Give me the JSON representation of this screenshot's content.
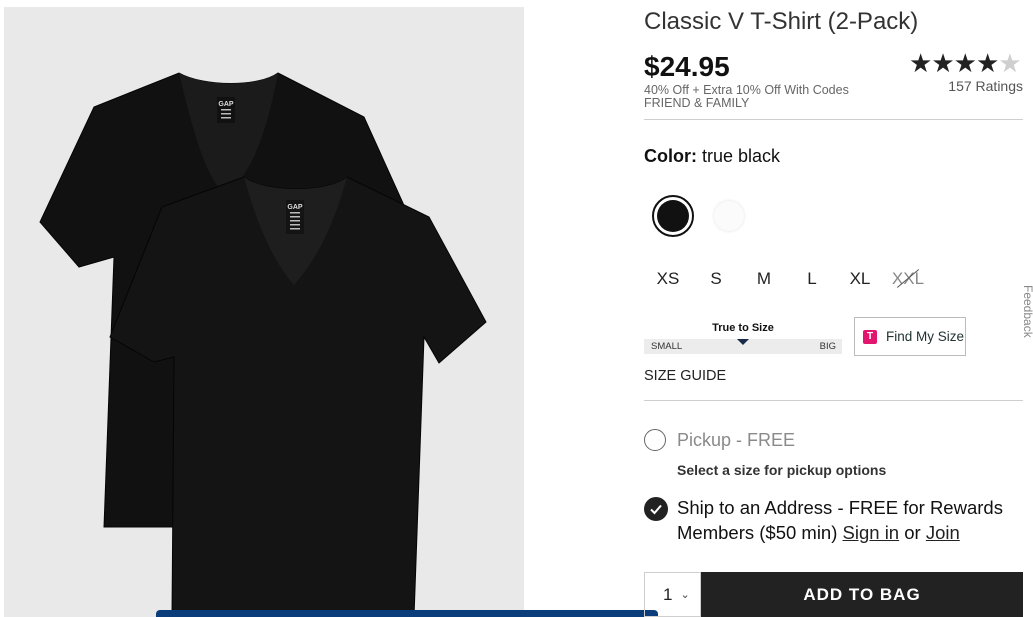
{
  "product": {
    "title": "Classic V T-Shirt (2-Pack)",
    "price": "$24.95",
    "promo_line1": "40% Off + Extra 10% Off With Codes",
    "promo_line2": "FRIEND & FAMILY",
    "rating_value": 4.5,
    "rating_max": 5,
    "ratings_count": "157 Ratings",
    "image_alt": "Two black v-neck t-shirts",
    "tag_brand": "GAP"
  },
  "color": {
    "label": "Color:",
    "selected_name": "true black",
    "swatches": [
      {
        "name": "true black",
        "hex": "#111111",
        "selected": true
      },
      {
        "name": "white",
        "hex": "#fbfbfb",
        "selected": false
      }
    ]
  },
  "sizes": [
    {
      "label": "XS",
      "available": true
    },
    {
      "label": "S",
      "available": true
    },
    {
      "label": "M",
      "available": true
    },
    {
      "label": "L",
      "available": true
    },
    {
      "label": "XL",
      "available": true
    },
    {
      "label": "XXL",
      "available": false
    }
  ],
  "fit": {
    "title": "True to Size",
    "small_label": "SMALL",
    "big_label": "BIG",
    "position": 0.5
  },
  "find_my_size": {
    "icon_letter": "T",
    "label": "Find My Size"
  },
  "size_guide": "SIZE GUIDE",
  "fulfillment": {
    "pickup_label": "Pickup - FREE",
    "pickup_note": "Select a size for pickup options",
    "ship_label": "Ship to an Address - FREE for Rewards Members ($50 min)",
    "sign_in": "Sign in",
    "or": "or",
    "join": "Join"
  },
  "cart": {
    "quantity": "1",
    "add_label": "ADD TO BAG"
  },
  "feedback_label": "Feedback",
  "colors": {
    "accent_dark": "#222222",
    "bottom_bar": "#0b3d7a",
    "find_size_icon": "#e2166f"
  }
}
